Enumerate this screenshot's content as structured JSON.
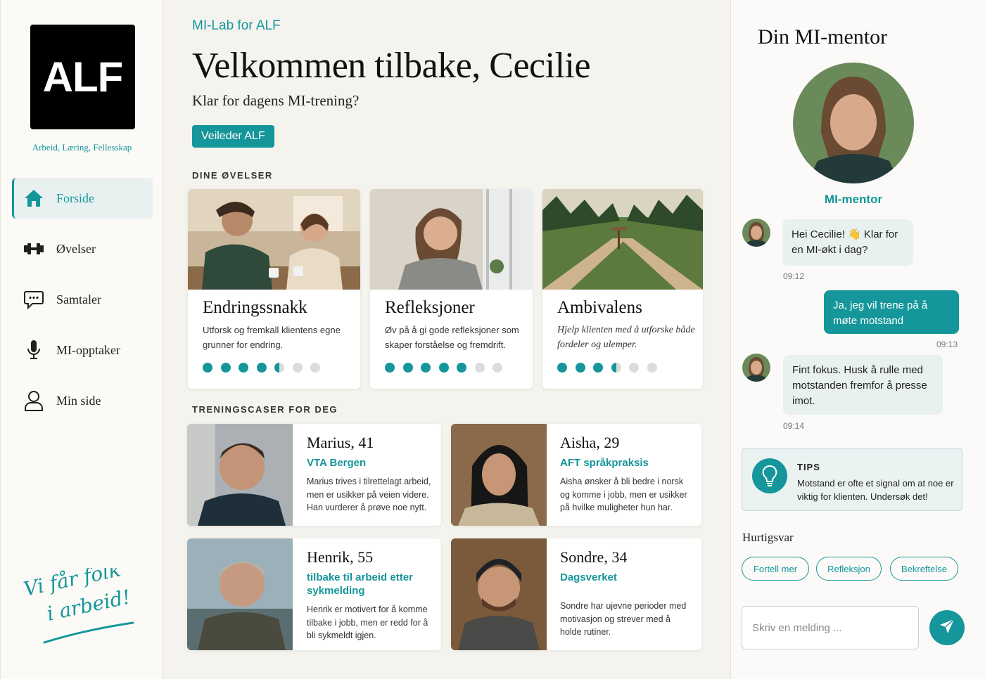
{
  "brand": {
    "logo_text": "ALF",
    "tagline": "Arbeid, Læring, Fellesskap",
    "slogan_line1": "Vi får folk",
    "slogan_line2": "i arbeid!"
  },
  "nav": [
    {
      "label": "Forside",
      "icon": "home-icon",
      "active": true
    },
    {
      "label": "Øvelser",
      "icon": "dumbbell-icon",
      "active": false
    },
    {
      "label": "Samtaler",
      "icon": "chat-bubble-icon",
      "active": false
    },
    {
      "label": "MI-opptaker",
      "icon": "microphone-icon",
      "active": false
    },
    {
      "label": "Min side",
      "icon": "user-icon",
      "active": false
    }
  ],
  "header": {
    "crumb": "MI-Lab for ALF",
    "title": "Velkommen tilbake, Cecilie",
    "subtitle": "Klar for dagens MI-trening?",
    "role_badge": "Veileder ALF"
  },
  "exercises_heading": "DINE ØVELSER",
  "exercises": [
    {
      "title": "Endringssnakk",
      "desc": "Utforsk og fremkall klientens egne grunner for endring.",
      "progress": 4.5,
      "total": 7
    },
    {
      "title": "Refleksjoner",
      "desc": "Øv på å gi gode refleksjoner som skaper forståelse og fremdrift.",
      "progress": 5,
      "total": 7
    },
    {
      "title": "Ambivalens",
      "desc": "Hjelp klienten med å utforske både fordeler og ulemper.",
      "progress": 3.5,
      "total": 6
    }
  ],
  "cases_heading": "TRENINGSCASER FOR DEG",
  "cases": [
    {
      "name": "Marius, 41",
      "org": "VTA Bergen",
      "desc": "Marius trives i tilrettelagt arbeid, men er usikker på veien videre. Han vurderer å prøve noe nytt."
    },
    {
      "name": "Aisha, 29",
      "org": "AFT språkpraksis",
      "desc": "Aisha ønsker å bli bedre i norsk og komme i jobb, men er usikker på hvilke muligheter hun har."
    },
    {
      "name": "Henrik, 55",
      "org": "tilbake til arbeid etter sykmelding",
      "desc": "Henrik er motivert for å komme tilbake i jobb, men er redd for å bli sykmeldt igjen."
    },
    {
      "name": "Sondre, 34",
      "org": "Dagsverket",
      "desc": "Sondre har ujevne perioder med motivasjon og strever med å holde rutiner."
    }
  ],
  "mentor": {
    "title": "Din MI-mentor",
    "label": "MI-mentor",
    "messages": [
      {
        "from": "mentor",
        "text": "Hei Cecilie! 👋 Klar for en MI-økt i dag?",
        "time": "09:12"
      },
      {
        "from": "me",
        "text": "Ja, jeg vil trene på å møte motstand",
        "time": "09:13"
      },
      {
        "from": "mentor",
        "text": "Fint fokus. Husk å rulle med motstanden fremfor å presse imot.",
        "time": "09:14"
      }
    ],
    "tips_heading": "TIPS",
    "tips_text": "Motstand er ofte et signal om at noe er viktig for klienten. Undersøk det!",
    "quick_heading": "Hurtigsvar",
    "quick_replies": [
      "Fortell mer",
      "Refleksjon",
      "Bekreftelse"
    ],
    "input_placeholder": "Skriv en melding ...",
    "accent": "#15969a"
  }
}
